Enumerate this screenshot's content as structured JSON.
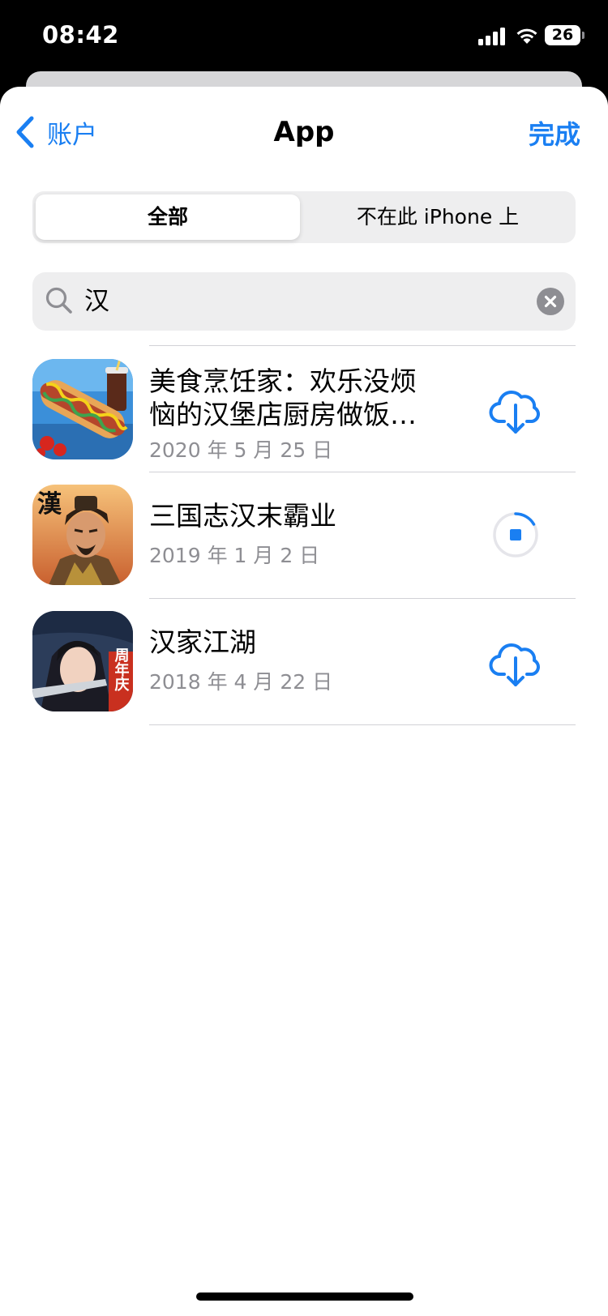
{
  "status_bar": {
    "time": "08:42",
    "battery": "26"
  },
  "nav": {
    "back_label": "账户",
    "title": "App",
    "done_label": "完成"
  },
  "segments": {
    "all": "全部",
    "not_on_device": "不在此 iPhone 上"
  },
  "search": {
    "value": "汉"
  },
  "apps": [
    {
      "name": "美食烹饪家：欢乐没烦恼的汉堡店厨房做饭…",
      "date": "2020 年 5 月 25 日",
      "action": "cloud-download-icon"
    },
    {
      "name": "三国志汉末霸业",
      "date": "2019 年 1 月 2 日",
      "action": "download-progress-stop-icon"
    },
    {
      "name": "汉家江湖",
      "date": "2018 年 4 月 22 日",
      "action": "cloud-download-icon"
    }
  ],
  "icon_badges": {
    "app2": "漢",
    "app3": "周年庆"
  },
  "colors": {
    "accent": "#1a7ff2",
    "secondary_text": "#8e8e93",
    "separator": "#d1d1d6"
  }
}
